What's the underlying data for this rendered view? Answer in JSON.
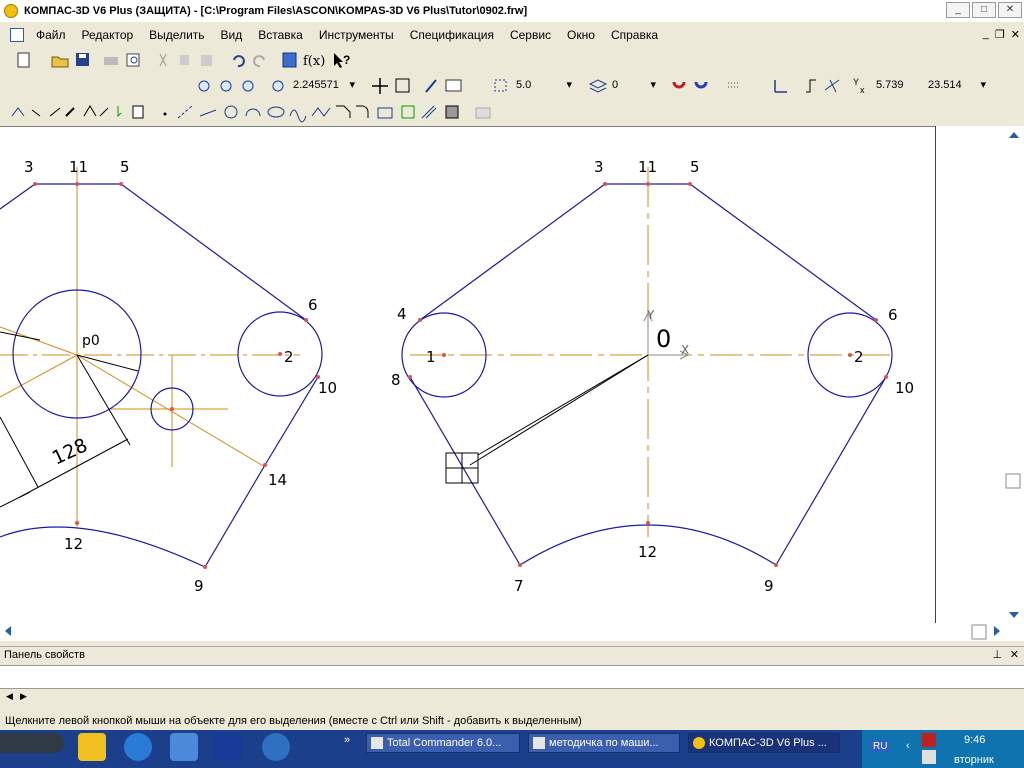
{
  "window": {
    "title": "КОМПАС-3D V6 Plus (ЗАЩИТА) - [C:\\Program Files\\ASCON\\KOMPAS-3D V6 Plus\\Tutor\\0902.frw]"
  },
  "menu": [
    "Файл",
    "Редактор",
    "Выделить",
    "Вид",
    "Вставка",
    "Инструменты",
    "Спецификация",
    "Сервис",
    "Окно",
    "Справка"
  ],
  "toolbar": {
    "zoom": "2.245571",
    "step": "5.0",
    "layer": "0",
    "coord_x": "5.739",
    "coord_y": "23.514"
  },
  "drawing": {
    "left_labels": [
      "3",
      "11",
      "5",
      "6",
      "2",
      "10",
      "14",
      "12",
      "9",
      "p0",
      "128"
    ],
    "right_labels": [
      "3",
      "11",
      "5",
      "4",
      "6",
      "8",
      "10",
      "1",
      "2",
      "12",
      "7",
      "9",
      "0",
      "Y",
      "X"
    ]
  },
  "props_panel": {
    "title": "Панель свойств"
  },
  "status": {
    "message": "Щелкните левой кнопкой мыши на объекте для его выделения (вместе с Ctrl или Shift - добавить к выделенным)"
  },
  "taskbar": {
    "tasks": [
      "Total Commander 6.0...",
      "методичка по маши...",
      "КОМПАС-3D V6 Plus ..."
    ],
    "lang": "RU",
    "time": "9:46",
    "day": "вторник"
  },
  "colors": {
    "contour": "#1a1aa8",
    "axis": "#d98a16",
    "point": "#e05050",
    "dim": "#000000"
  }
}
